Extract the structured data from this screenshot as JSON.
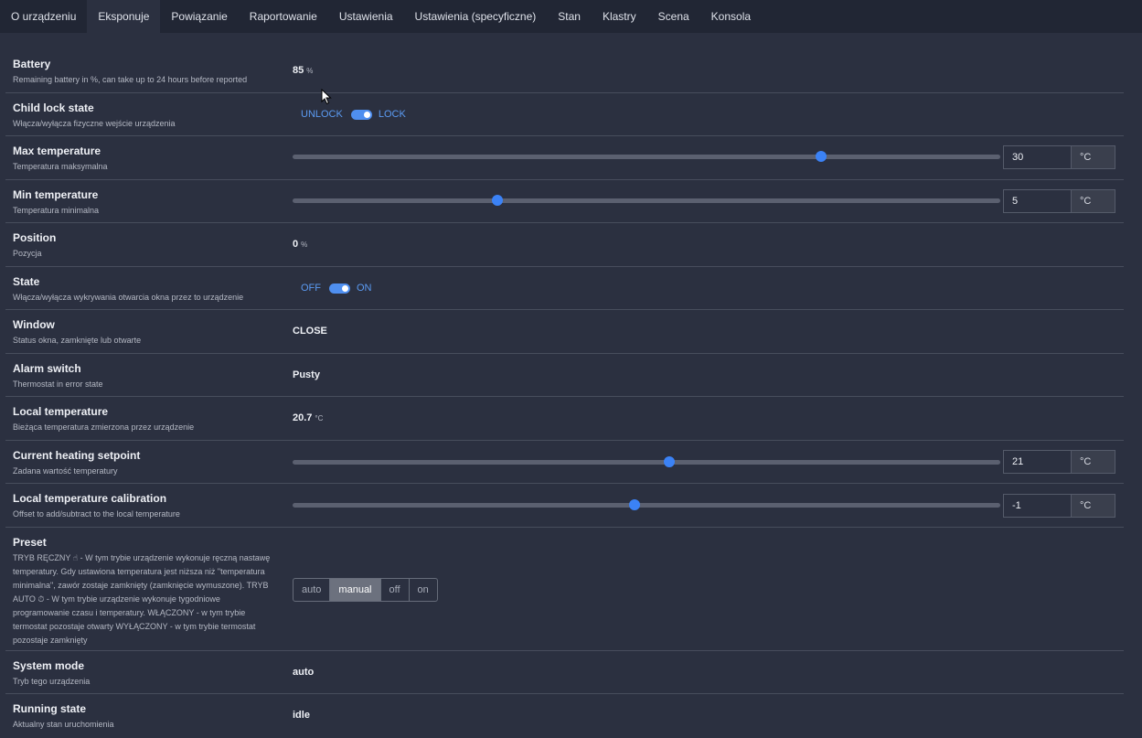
{
  "tabs": [
    {
      "label": "O urządzeniu",
      "active": false
    },
    {
      "label": "Eksponuje",
      "active": true
    },
    {
      "label": "Powiązanie",
      "active": false
    },
    {
      "label": "Raportowanie",
      "active": false
    },
    {
      "label": "Ustawienia",
      "active": false
    },
    {
      "label": "Ustawienia (specyficzne)",
      "active": false
    },
    {
      "label": "Stan",
      "active": false
    },
    {
      "label": "Klastry",
      "active": false
    },
    {
      "label": "Scena",
      "active": false
    },
    {
      "label": "Konsola",
      "active": false
    }
  ],
  "battery": {
    "title": "Battery",
    "desc": "Remaining battery in %, can take up to 24 hours before reported",
    "value": "85",
    "unit": "%"
  },
  "child_lock": {
    "title": "Child lock state",
    "desc": "Włącza/wyłącza fizyczne wejście urządzenia",
    "off_label": "UNLOCK",
    "on_label": "LOCK"
  },
  "max_temp": {
    "title": "Max temperature",
    "desc": "Temperatura maksymalna",
    "value": "30",
    "unit": "°C",
    "fraction": 0.747
  },
  "min_temp": {
    "title": "Min temperature",
    "desc": "Temperatura minimalna",
    "value": "5",
    "unit": "°C",
    "fraction": 0.289
  },
  "position": {
    "title": "Position",
    "desc": "Pozycja",
    "value": "0",
    "unit": "%"
  },
  "state": {
    "title": "State",
    "desc": "Włącza/wyłącza wykrywania otwarcia okna przez to urządzenie",
    "off_label": "OFF",
    "on_label": "ON"
  },
  "window": {
    "title": "Window",
    "desc": "Status okna, zamknięte lub otwarte",
    "value": "CLOSE"
  },
  "alarm": {
    "title": "Alarm switch",
    "desc": "Thermostat in error state",
    "value": "Pusty"
  },
  "local_temp": {
    "title": "Local temperature",
    "desc": "Bieżąca temperatura zmierzona przez urządzenie",
    "value": "20.7",
    "unit": "°C"
  },
  "setpoint": {
    "title": "Current heating setpoint",
    "desc": "Zadana wartość temperatury",
    "value": "21",
    "unit": "°C",
    "fraction": 0.532
  },
  "calibration": {
    "title": "Local temperature calibration",
    "desc": "Offset to add/subtract to the local temperature",
    "value": "-1",
    "unit": "°C",
    "fraction": 0.483
  },
  "preset": {
    "title": "Preset",
    "desc": "TRYB RĘCZNY ☝ - W tym trybie urządzenie wykonuje ręczną nastawę temperatury. Gdy ustawiona temperatura jest niższa niż \"temperatura minimalna\", zawór zostaje zamknięty (zamknięcie wymuszone). TRYB AUTO ⏱ - W tym trybie urządzenie wykonuje tygodniowe programowanie czasu i temperatury. WŁĄCZONY - w tym trybie termostat pozostaje otwarty WYŁĄCZONY - w tym trybie termostat pozostaje zamknięty",
    "options": [
      "auto",
      "manual",
      "off",
      "on"
    ],
    "selected": "manual"
  },
  "system_mode": {
    "title": "System mode",
    "desc": "Tryb tego urządzenia",
    "value": "auto"
  },
  "running_state": {
    "title": "Running state",
    "desc": "Aktualny stan uruchomienia",
    "value": "idle"
  }
}
